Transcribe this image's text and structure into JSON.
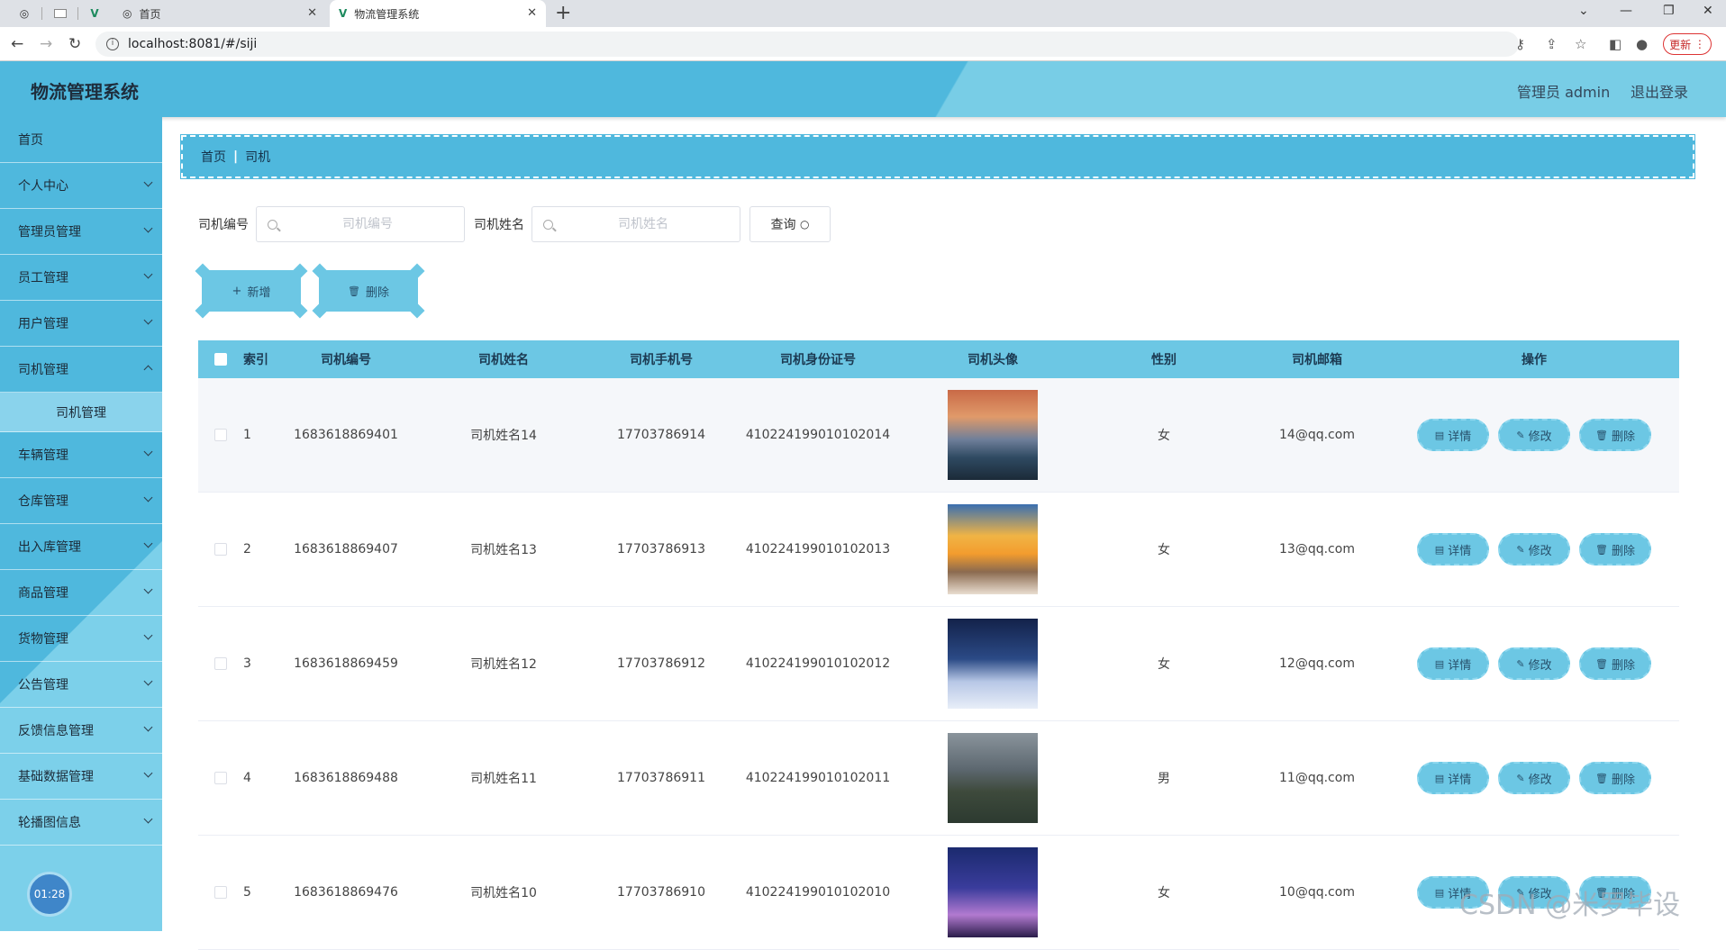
{
  "browser": {
    "tabs": [
      {
        "title": ""
      },
      {
        "title": ""
      },
      {
        "title": ""
      },
      {
        "title": "首页"
      },
      {
        "title": "物流管理系统"
      }
    ],
    "url": "localhost:8081/#/siji",
    "update_label": "更新"
  },
  "header": {
    "title": "物流管理系统",
    "user": "管理员 admin",
    "logout": "退出登录"
  },
  "sidebar": {
    "items": [
      {
        "label": "首页",
        "expandable": false
      },
      {
        "label": "个人中心",
        "expandable": true
      },
      {
        "label": "管理员管理",
        "expandable": true
      },
      {
        "label": "员工管理",
        "expandable": true
      },
      {
        "label": "用户管理",
        "expandable": true
      },
      {
        "label": "司机管理",
        "expandable": true
      },
      {
        "label": "车辆管理",
        "expandable": true
      },
      {
        "label": "仓库管理",
        "expandable": true
      },
      {
        "label": "出入库管理",
        "expandable": true
      },
      {
        "label": "商品管理",
        "expandable": true
      },
      {
        "label": "货物管理",
        "expandable": true
      },
      {
        "label": "公告管理",
        "expandable": true
      },
      {
        "label": "反馈信息管理",
        "expandable": true
      },
      {
        "label": "基础数据管理",
        "expandable": true
      },
      {
        "label": "轮播图信息",
        "expandable": true
      }
    ],
    "sub_item": "司机管理",
    "clock": "01:28"
  },
  "breadcrumb": {
    "home": "首页",
    "current": "司机"
  },
  "search": {
    "code_label": "司机编号",
    "code_placeholder": "司机编号",
    "name_label": "司机姓名",
    "name_placeholder": "司机姓名",
    "query_label": "查询"
  },
  "actions": {
    "add_label": "新增",
    "delete_label": "删除"
  },
  "table": {
    "columns": [
      "索引",
      "司机编号",
      "司机姓名",
      "司机手机号",
      "司机身份证号",
      "司机头像",
      "性别",
      "司机邮箱",
      "操作"
    ],
    "ops": {
      "detail": "详情",
      "edit": "修改",
      "delete": "删除"
    },
    "rows": [
      {
        "index": "1",
        "code": "1683618869401",
        "name": "司机姓名14",
        "phone": "17703786914",
        "idcard": "410224199010102014",
        "avatar": "lake-sunset",
        "gender": "女",
        "email": "14@qq.com"
      },
      {
        "index": "2",
        "code": "1683618869407",
        "name": "司机姓名13",
        "phone": "17703786913",
        "idcard": "410224199010102013",
        "avatar": "beach-sunset",
        "gender": "女",
        "email": "13@qq.com"
      },
      {
        "index": "3",
        "code": "1683618869459",
        "name": "司机姓名12",
        "phone": "17703786912",
        "idcard": "410224199010102012",
        "avatar": "snow-cabin",
        "gender": "女",
        "email": "12@qq.com"
      },
      {
        "index": "4",
        "code": "1683618869488",
        "name": "司机姓名11",
        "phone": "17703786911",
        "idcard": "410224199010102011",
        "avatar": "mountain-village",
        "gender": "男",
        "email": "11@qq.com"
      },
      {
        "index": "5",
        "code": "1683618869476",
        "name": "司机姓名10",
        "phone": "17703786910",
        "idcard": "410224199010102010",
        "avatar": "eiffel-tower",
        "gender": "女",
        "email": "10@qq.com"
      }
    ]
  },
  "watermark": "CSDN @米罗毕设"
}
